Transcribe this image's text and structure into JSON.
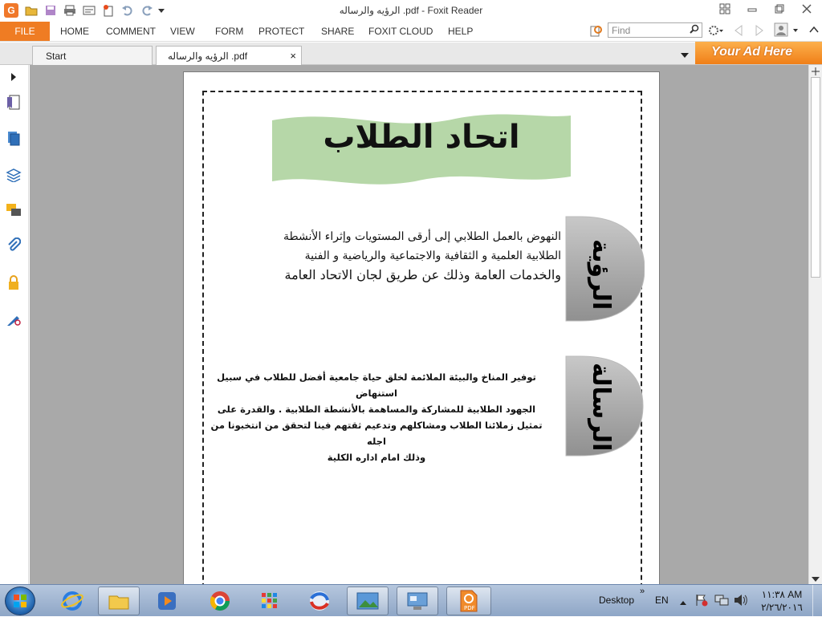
{
  "window": {
    "title": "الرؤيه والرساله .pdf - Foxit Reader",
    "logo_letter": "G"
  },
  "ribbon": {
    "file": "FILE",
    "tabs": [
      "HOME",
      "COMMENT",
      "VIEW",
      "FORM",
      "PROTECT",
      "SHARE",
      "FOXIT CLOUD",
      "HELP"
    ],
    "find_placeholder": "Find"
  },
  "doc_tabs": {
    "start": "Start",
    "active": "الرؤيه والرساله .pdf",
    "close": "×"
  },
  "ad_text": "Your Ad Here",
  "document": {
    "title": "اتحاد الطلاب",
    "vision_label": "الرؤية",
    "vision_lines": [
      "النهوض بالعمل الطلابي إلى أرقى المستويات وإثراء الأنشطة",
      "الطلابية العلمية و الثقافية والاجتماعية والرياضية   و الفنية",
      "والخدمات العامة  وذلك عن طريق لجان الاتحاد العامة"
    ],
    "mission_label": "الرسالة",
    "mission_lines": [
      "توفير المناخ والبيئة الملائمة لخلق حياة جامعية أفضل للطلاب في سبيل استنهاض",
      "الجهود الطلابية للمشاركة والمساهمة بالأنشطة الطلابية . والقدرة على",
      "تمثيل زملائنا الطلاب ومشاكلهم وتدعيم ثقتهم فينا لتحقق من انتخبونا من اجله",
      "وذلك امام اداره الكلية"
    ]
  },
  "taskbar": {
    "desktop": "Desktop",
    "lang": "EN",
    "time": "١١:٣٨ AM",
    "date": "٢/٢٦/٢٠١٦"
  },
  "colors": {
    "file_tab": "#ef7c23",
    "banner": "#b6d7a8",
    "label_shape": "#a8a8a8"
  }
}
